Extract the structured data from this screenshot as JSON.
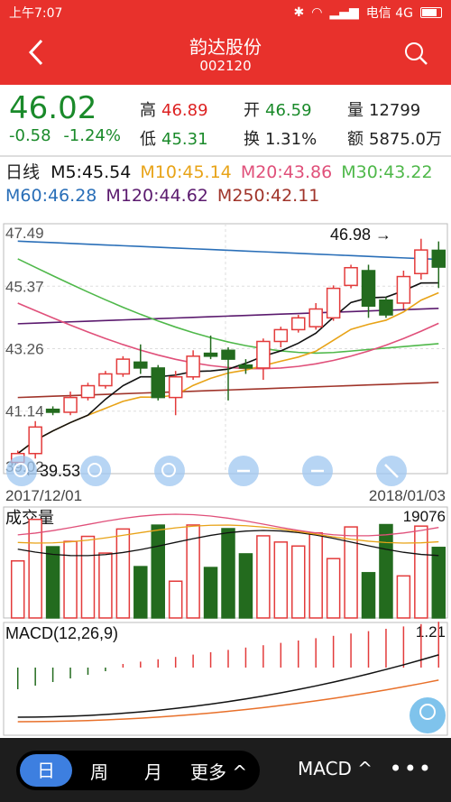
{
  "status": {
    "time": "上午7:07",
    "carrier": "电信 4G"
  },
  "header": {
    "title": "韵达股份",
    "code": "002120"
  },
  "quote": {
    "price": "46.02",
    "change": "-0.58",
    "change_pct": "-1.24%",
    "high_label": "高",
    "high": "46.89",
    "low_label": "低",
    "low": "45.31",
    "open_label": "开",
    "open": "46.59",
    "turnover_label": "换",
    "turnover": "1.31%",
    "volume_label": "量",
    "volume": "12799",
    "amount_label": "额",
    "amount": "5875.0万"
  },
  "ma": {
    "period": "日线",
    "ma5": "M5:45.54",
    "ma10": "M10:45.14",
    "ma20": "M20:43.86",
    "ma30": "M30:43.22",
    "ma60": "M60:46.28",
    "ma120": "M120:44.62",
    "ma250": "M250:42.11"
  },
  "colors": {
    "ma5": "#111111",
    "ma10": "#e8a317",
    "ma20": "#e0507a",
    "ma30": "#4fb84a",
    "ma60": "#2a6fb8",
    "ma120": "#5b1a6e",
    "ma250": "#a0342a",
    "up": "#e33b3b",
    "down": "#236b1e"
  },
  "chart": {
    "y_labels": [
      "47.49",
      "45.37",
      "43.26",
      "41.14",
      "39.02"
    ],
    "max_label": "46.98",
    "min_label": "39.53",
    "date_start": "2017/12/01",
    "date_end": "2018/01/03"
  },
  "chart_data": {
    "type": "candlestick",
    "x_range": [
      "2017/12/01",
      "2018/01/03"
    ],
    "ylim": [
      39.02,
      47.49
    ],
    "candles": [
      {
        "o": 39.4,
        "c": 39.7,
        "h": 39.8,
        "l": 39.3
      },
      {
        "o": 39.7,
        "c": 40.6,
        "h": 40.8,
        "l": 39.53
      },
      {
        "o": 41.2,
        "c": 41.1,
        "h": 41.3,
        "l": 41.0
      },
      {
        "o": 41.1,
        "c": 41.6,
        "h": 41.8,
        "l": 41.0
      },
      {
        "o": 41.6,
        "c": 42.0,
        "h": 42.1,
        "l": 41.5
      },
      {
        "o": 42.0,
        "c": 42.4,
        "h": 42.5,
        "l": 41.9
      },
      {
        "o": 42.4,
        "c": 42.9,
        "h": 43.0,
        "l": 42.3
      },
      {
        "o": 42.8,
        "c": 42.6,
        "h": 43.4,
        "l": 42.4
      },
      {
        "o": 42.6,
        "c": 41.6,
        "h": 42.7,
        "l": 41.5
      },
      {
        "o": 41.6,
        "c": 42.3,
        "h": 42.5,
        "l": 41.0
      },
      {
        "o": 42.3,
        "c": 43.0,
        "h": 43.2,
        "l": 42.2
      },
      {
        "o": 43.1,
        "c": 43.0,
        "h": 43.7,
        "l": 42.9
      },
      {
        "o": 43.2,
        "c": 42.9,
        "h": 43.3,
        "l": 41.5
      },
      {
        "o": 42.7,
        "c": 42.6,
        "h": 42.9,
        "l": 42.4
      },
      {
        "o": 42.6,
        "c": 43.5,
        "h": 43.6,
        "l": 42.2
      },
      {
        "o": 43.5,
        "c": 43.9,
        "h": 44.0,
        "l": 43.3
      },
      {
        "o": 43.9,
        "c": 44.3,
        "h": 44.4,
        "l": 43.8
      },
      {
        "o": 44.0,
        "c": 44.6,
        "h": 44.8,
        "l": 43.9
      },
      {
        "o": 44.3,
        "c": 45.3,
        "h": 45.4,
        "l": 44.2
      },
      {
        "o": 45.4,
        "c": 46.0,
        "h": 46.1,
        "l": 45.3
      },
      {
        "o": 45.9,
        "c": 44.7,
        "h": 46.1,
        "l": 44.3
      },
      {
        "o": 44.9,
        "c": 44.4,
        "h": 45.0,
        "l": 44.3
      },
      {
        "o": 44.8,
        "c": 45.7,
        "h": 45.9,
        "l": 44.6
      },
      {
        "o": 45.8,
        "c": 46.6,
        "h": 46.98,
        "l": 45.6
      },
      {
        "o": 46.59,
        "c": 46.02,
        "h": 46.89,
        "l": 45.31
      }
    ],
    "volume_max_label": "19076",
    "macd_label": "MACD(12,26,9)",
    "macd_max_label": "1.21"
  },
  "labels": {
    "volume_title": "成交量"
  },
  "tabs": {
    "day": "日",
    "week": "周",
    "month": "月",
    "more": "更多 ^",
    "macd": "MACD ^",
    "dots": "•••"
  }
}
